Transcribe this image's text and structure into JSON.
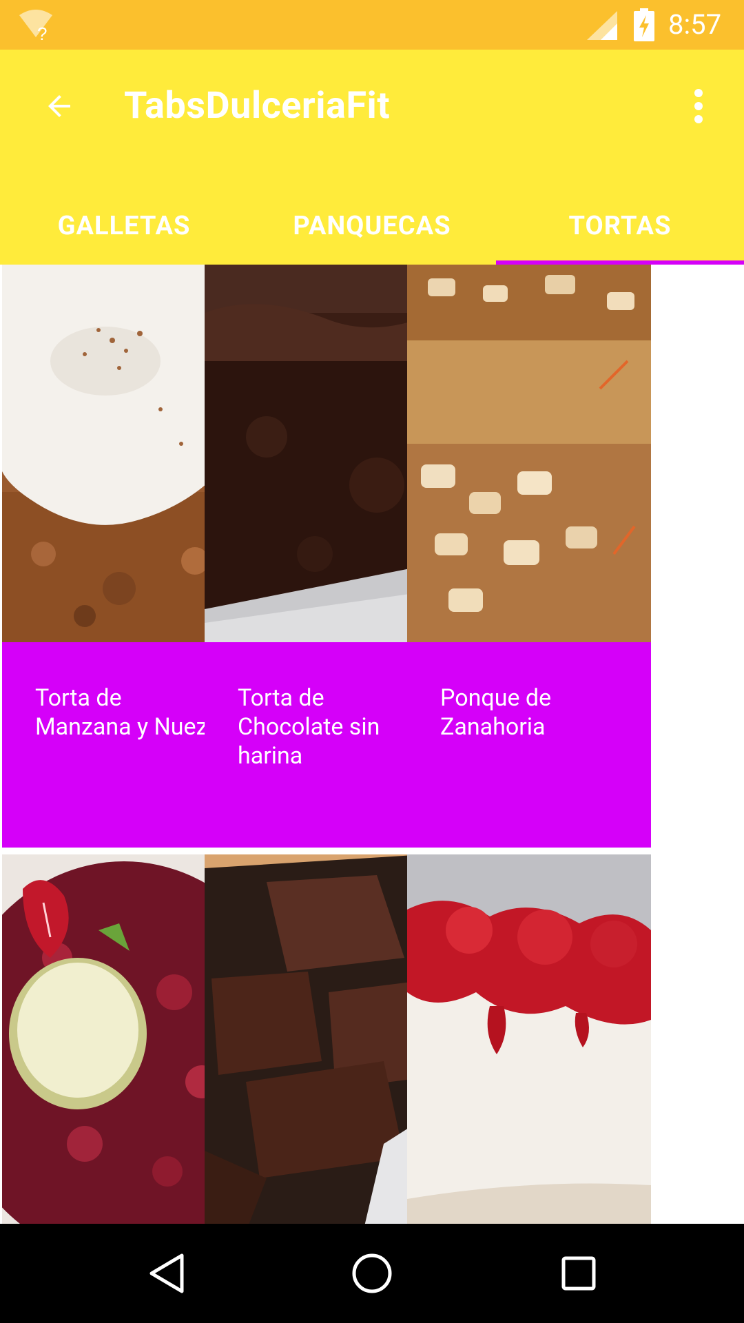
{
  "status_bar": {
    "time": "8:57",
    "wifi_badge": "?",
    "icons": [
      "wifi-unknown-icon",
      "signal-icon",
      "battery-charging-icon"
    ]
  },
  "app_bar": {
    "title": "TabsDulceriaFit",
    "back_icon": "arrow-back-icon",
    "menu_icon": "more-vert-icon"
  },
  "tabs": [
    {
      "label": "GALLETAS",
      "active": false
    },
    {
      "label": "PANQUECAS",
      "active": false
    },
    {
      "label": "TORTAS",
      "active": true
    }
  ],
  "cards": [
    {
      "title": "Torta de Manzana y Nuez",
      "image": "apple-walnut-cake-photo"
    },
    {
      "title": "Torta de Chocolate sin harina",
      "image": "flourless-chocolate-cake-photo"
    },
    {
      "title": "Ponque de Zanahoria",
      "image": "carrot-cake-photo"
    },
    {
      "title": "",
      "image": "berry-tart-with-apple-photo"
    },
    {
      "title": "",
      "image": "brownies-photo"
    },
    {
      "title": "",
      "image": "strawberry-cheesecake-photo"
    }
  ],
  "nav_bar": {
    "icons": [
      "back-triangle-icon",
      "home-circle-icon",
      "recents-square-icon"
    ]
  },
  "colors": {
    "status_bar": "#FBC02D",
    "app_bar": "#FFEB3B",
    "accent": "#D500F9",
    "nav_bar": "#000000"
  }
}
